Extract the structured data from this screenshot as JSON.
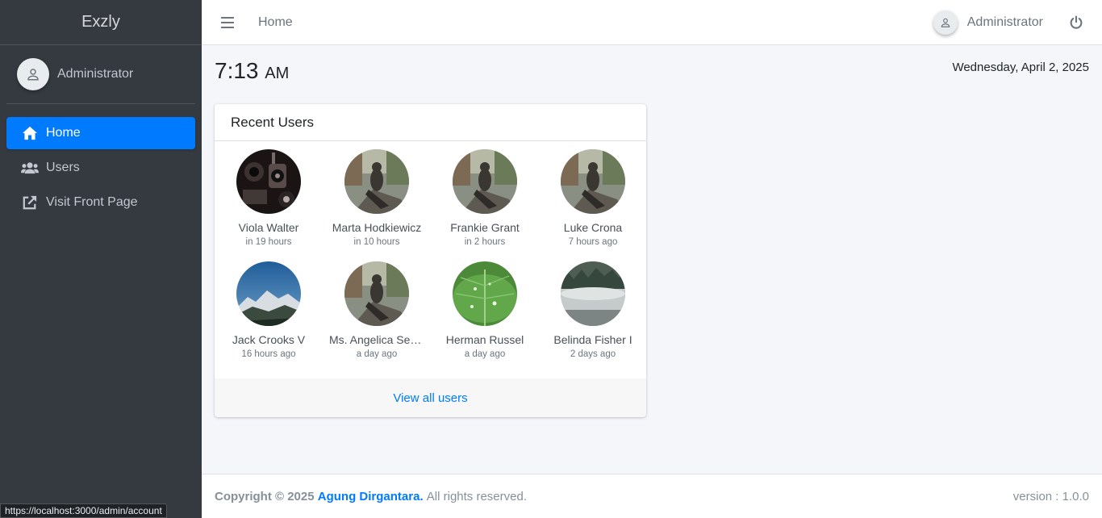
{
  "brand": "Exzly",
  "sidebar": {
    "user_name": "Administrator",
    "items": [
      {
        "label": "Home",
        "icon": "home-icon",
        "active": true
      },
      {
        "label": "Users",
        "icon": "users-icon",
        "active": false
      },
      {
        "label": "Visit Front Page",
        "icon": "external-link-icon",
        "active": false
      }
    ]
  },
  "topbar": {
    "breadcrumb": "Home",
    "user_name": "Administrator"
  },
  "clock": {
    "time": "7:13",
    "ampm": "AM"
  },
  "date": "Wednesday, April 2, 2025",
  "recent_users": {
    "title": "Recent Users",
    "view_all": "View all users",
    "users": [
      {
        "name": "Viola Walter",
        "time": "in 19 hours"
      },
      {
        "name": "Marta Hodkiewicz",
        "time": "in 10 hours"
      },
      {
        "name": "Frankie Grant",
        "time": "in 2 hours"
      },
      {
        "name": "Luke Crona",
        "time": "7 hours ago"
      },
      {
        "name": "Jack Crooks V",
        "time": "16 hours ago"
      },
      {
        "name": "Ms. Angelica Senger",
        "time": "a day ago"
      },
      {
        "name": "Herman Russel",
        "time": "a day ago"
      },
      {
        "name": "Belinda Fisher I",
        "time": "2 days ago"
      }
    ]
  },
  "footer": {
    "copyright": "Copyright © 2025",
    "author": "Agung Dirgantara.",
    "rights": "All rights reserved.",
    "version": "version : 1.0.0"
  },
  "status_url": "https://localhost:3000/admin/account",
  "colors": {
    "accent": "#007bff",
    "sidebar": "#343a40"
  }
}
